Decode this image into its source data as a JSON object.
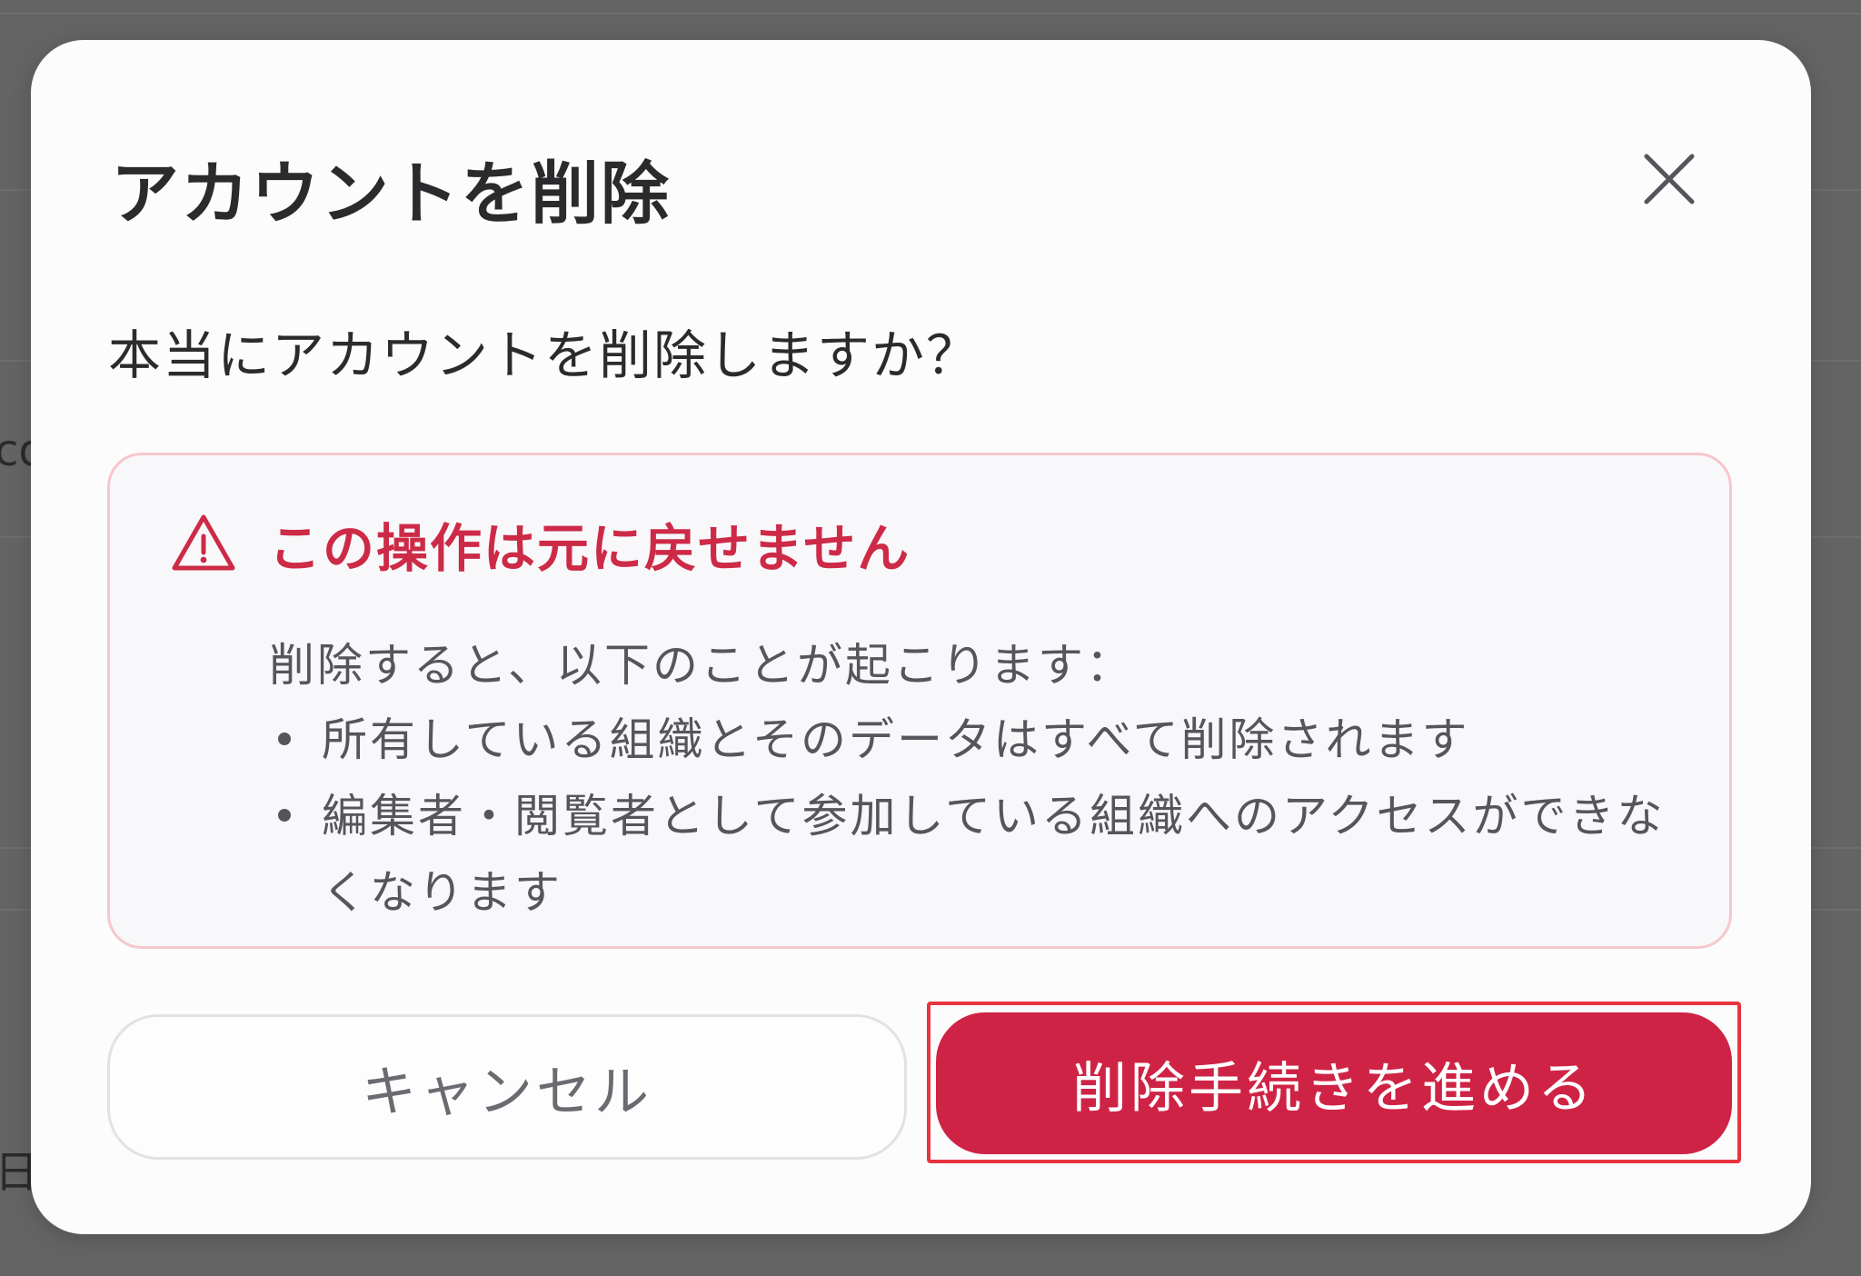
{
  "background": {
    "partial_text_1": "co",
    "partial_text_2": "日"
  },
  "dialog": {
    "title": "アカウントを削除",
    "close_icon": "close-icon",
    "question": "本当にアカウントを削除しますか？",
    "warning": {
      "icon": "warning-triangle-icon",
      "heading": "この操作は元に戻せません",
      "description": "削除すると、以下のことが起こります：",
      "items": [
        "所有している組織とそのデータはすべて削除されます",
        "編集者・閲覧者として参加している組織へのアクセスができなくなります"
      ]
    },
    "cancel_label": "キャンセル",
    "confirm_label": "削除手続きを進める"
  },
  "colors": {
    "accent_red": "#cf2346",
    "warning_text": "#cd2a47",
    "warning_border": "#f6c7cc",
    "highlight_outline": "#e8343f"
  }
}
